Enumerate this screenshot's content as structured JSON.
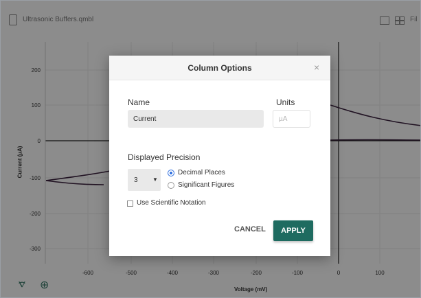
{
  "toolbar": {
    "file_title": "Ultrasonic Buffers.qmbl",
    "more_label": "Fil"
  },
  "graph": {
    "y_axis_label": "Current (µA)",
    "x_axis_label": "Voltage (mV)",
    "y_ticks": [
      "200",
      "100",
      "0",
      "-100",
      "-200",
      "-300"
    ],
    "x_ticks": [
      "-600",
      "-500",
      "-400",
      "-300",
      "-200",
      "-100",
      "0",
      "100"
    ],
    "trace_color": "#3d2340"
  },
  "dialog": {
    "title": "Column Options",
    "close_glyph": "×",
    "name_label": "Name",
    "name_value": "Current",
    "units_label": "Units",
    "units_placeholder": "µA",
    "precision_label": "Displayed Precision",
    "precision_value": "3",
    "precision_arrow": "▼",
    "radio_decimal": "Decimal Places",
    "radio_significant": "Significant Figures",
    "radio_selected": "decimal",
    "scientific_label": "Use Scientific Notation",
    "scientific_checked": false,
    "cancel_label": "CANCEL",
    "apply_label": "APPLY",
    "accent_color": "#1e6b60"
  }
}
